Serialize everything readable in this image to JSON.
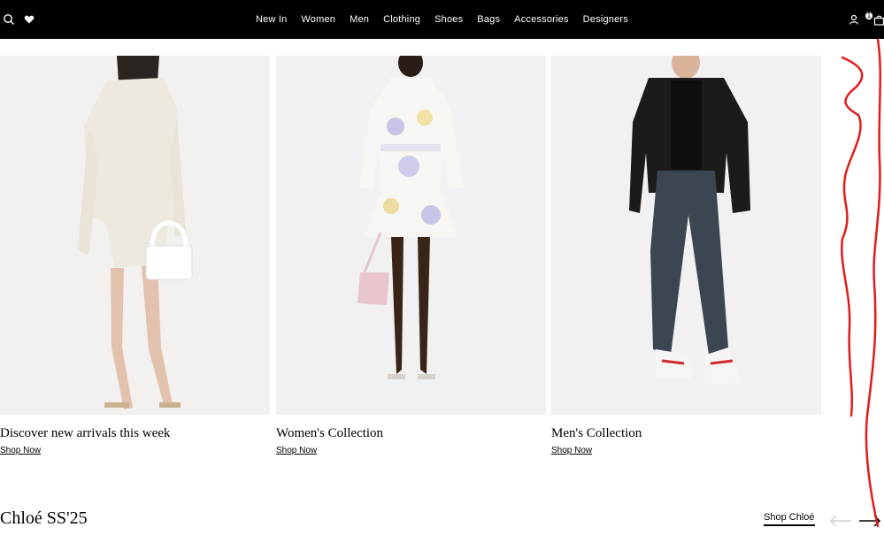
{
  "header": {
    "nav": [
      "New In",
      "Women",
      "Men",
      "Clothing",
      "Shoes",
      "Bags",
      "Accessories",
      "Designers"
    ],
    "icons": {
      "search": "search-icon",
      "wishlist": "heart-icon",
      "account": "user-icon",
      "bag": "bag-icon"
    },
    "bag_count": "1"
  },
  "cards": [
    {
      "title": "Discover new arrivals this week",
      "cta": "Shop Now"
    },
    {
      "title": "Women's Collection",
      "cta": "Shop Now"
    },
    {
      "title": "Men's Collection",
      "cta": "Shop Now"
    }
  ],
  "section": {
    "title": "Chloé SS'25",
    "link": "Shop Chloé"
  },
  "colors": {
    "header_bg": "#000000",
    "annotation": "#e31b1b"
  }
}
